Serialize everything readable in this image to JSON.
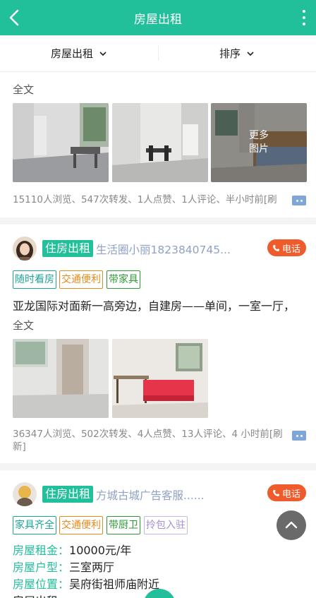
{
  "header": {
    "title": "房屋出租"
  },
  "filter": {
    "category": "房屋出租",
    "sort": "排序"
  },
  "post1": {
    "full_text": "全文",
    "more_images": [
      "更多",
      "图片"
    ],
    "stats": "15110人浏览、547次转发、1人点赞、1人评论、半小时前[刷"
  },
  "post2": {
    "type_tag": "住房出租",
    "poster": "生活圈小丽1823840745...",
    "call": "电话",
    "features": [
      "随时看房",
      "交通便利",
      "带家具"
    ],
    "description": "亚龙国际对面新一高旁边，自建房——单间，一室一厅，",
    "full_text": "全文",
    "stats_line1": "36347人浏览、502次转发、4人点赞、13人评论、4 小时前[刷",
    "stats_line2": "新]"
  },
  "post3": {
    "type_tag": "住房出租",
    "poster": "方城古城广告客服......",
    "call": "电话",
    "features": [
      "家具齐全",
      "交通便利",
      "带厨卫",
      "拎包入驻"
    ],
    "details": [
      {
        "key": "房屋租金：",
        "value": "10000元/年"
      },
      {
        "key": "房屋户型：",
        "value": "三室两厅"
      },
      {
        "key": "房屋位置：",
        "value": "吴府街祖师庙附近"
      },
      {
        "key": "房屋出租：",
        "value": ""
      }
    ]
  },
  "colors": {
    "accent": "#22bf9b",
    "call": "#ef5b2b",
    "poster": "#8fa1c5"
  }
}
